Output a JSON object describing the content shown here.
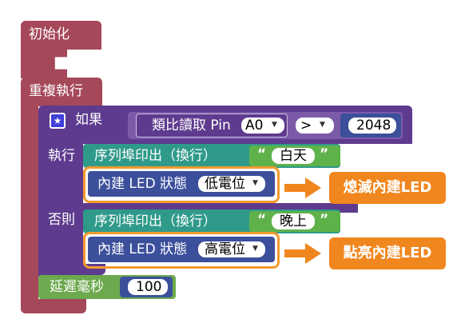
{
  "blocks": {
    "init_label": "初始化",
    "repeat_label": "重複執行",
    "if_block": {
      "if_label": "如果",
      "analog_read_label": "類比讀取 Pin",
      "pin_value": "A0",
      "operator": ">",
      "compare_value": "2048",
      "do_label": "執行",
      "else_label": "否則"
    },
    "then_branch": {
      "serial_label": "序列埠印出（換行）",
      "string_value": "白天",
      "led_label": "內建 LED 狀態",
      "led_state": "低電位"
    },
    "else_branch": {
      "serial_label": "序列埠印出（換行）",
      "string_value": "晚上",
      "led_label": "內建 LED 狀態",
      "led_state": "高電位"
    },
    "delay_label": "延遲毫秒",
    "delay_value": "100"
  },
  "callouts": {
    "then_callout": "熄滅內建LED",
    "else_callout": "點亮內建LED"
  },
  "colors": {
    "setup_block": "#a5485a",
    "if_block": "#5e3b8e",
    "operator_block": "#7b5aa8",
    "serial_block": "#2f9a8a",
    "string_block": "#5fb24a",
    "led_block": "#3b4f9b",
    "delay_block": "#6da94e",
    "highlight": "#f39a2d"
  }
}
